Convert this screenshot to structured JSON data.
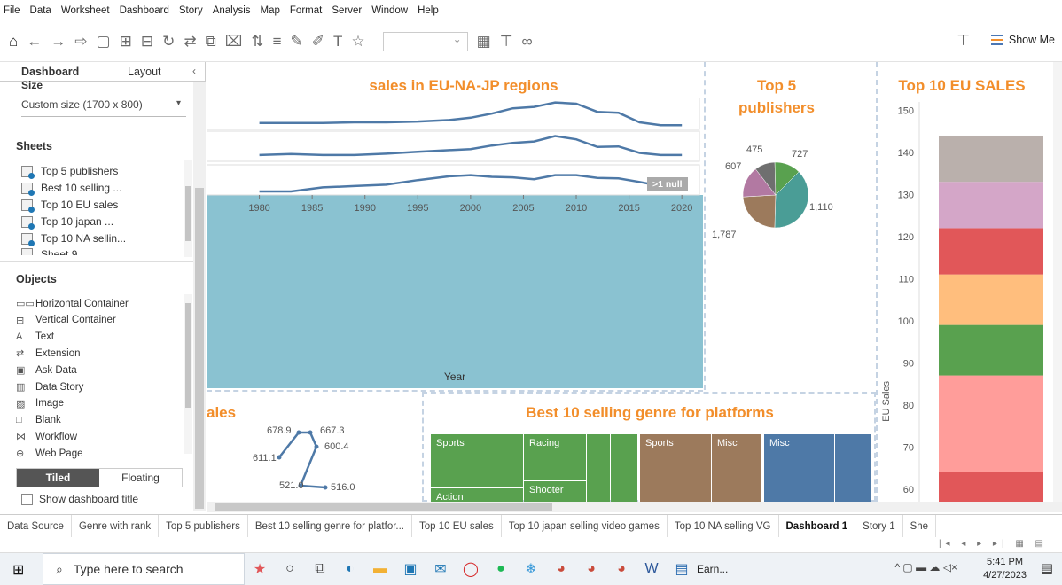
{
  "menu": [
    "File",
    "Data",
    "Worksheet",
    "Dashboard",
    "Story",
    "Analysis",
    "Map",
    "Format",
    "Server",
    "Window",
    "Help"
  ],
  "toolbar": {
    "show_me": "Show Me"
  },
  "left_panel": {
    "tab_dashboard": "Dashboard",
    "tab_layout": "Layout",
    "size_heading": "Size",
    "size_value": "Custom size (1700 x 800)",
    "sheets_heading": "Sheets",
    "sheets": [
      "Top 5 publishers",
      "Best 10 selling ...",
      "Top 10 EU sales",
      "Top 10 japan ...",
      "Top 10 NA sellin...",
      "Sheet 9"
    ],
    "objects_heading": "Objects",
    "objects": [
      {
        "icon": "horizontal-container-icon",
        "glyph": "▭▭",
        "label": "Horizontal Container"
      },
      {
        "icon": "vertical-container-icon",
        "glyph": "⊟",
        "label": "Vertical Container"
      },
      {
        "icon": "text-icon",
        "glyph": "A",
        "label": "Text"
      },
      {
        "icon": "extension-icon",
        "glyph": "⇄",
        "label": "Extension"
      },
      {
        "icon": "ask-data-icon",
        "glyph": "▣",
        "label": "Ask Data"
      },
      {
        "icon": "data-story-icon",
        "glyph": "▥",
        "label": "Data Story"
      },
      {
        "icon": "image-icon",
        "glyph": "▨",
        "label": "Image"
      },
      {
        "icon": "blank-icon",
        "glyph": "□",
        "label": "Blank"
      },
      {
        "icon": "workflow-icon",
        "glyph": "⋈",
        "label": "Workflow"
      },
      {
        "icon": "web-page-icon",
        "glyph": "⊕",
        "label": "Web Page"
      }
    ],
    "tiled": "Tiled",
    "floating": "Floating",
    "show_title": "Show dashboard title"
  },
  "dashboard": {
    "line_title": "sales in EU-NA-JP  regions",
    "null_badge": ">1 null",
    "year_label": "Year",
    "pie_title_1": "Top 5",
    "pie_title_2": "publishers",
    "bar_title": "Top 10 EU SALES",
    "bar_ylabel": "EU Sales",
    "small_title": "ales",
    "treemap_title": "Best 10 selling genre for platforms",
    "treemap_cells": [
      "Sports",
      "Racing",
      "Sports",
      "Misc",
      "Misc",
      "Shooter",
      "Action"
    ]
  },
  "chart_data": [
    {
      "type": "line",
      "title": "sales in EU-NA-JP  regions",
      "xlabel": "Year",
      "x_ticks": [
        1980,
        1985,
        1990,
        1995,
        2000,
        2005,
        2010,
        2015,
        2020
      ],
      "x": [
        1980,
        1983,
        1986,
        1989,
        1992,
        1995,
        1998,
        2000,
        2002,
        2004,
        2006,
        2008,
        2010,
        2012,
        2014,
        2016,
        2018,
        2020
      ],
      "series": [
        {
          "values": [
            1,
            1,
            1,
            1.2,
            1.2,
            1.5,
            2,
            2.8,
            4.2,
            6,
            6.5,
            8,
            7.6,
            4.8,
            4.5,
            1.2,
            0.2,
            0.2
          ]
        },
        {
          "values": [
            1,
            1.4,
            1,
            1,
            1.5,
            2.2,
            2.8,
            3.2,
            4.5,
            5.5,
            6,
            8,
            6.8,
            4,
            4.2,
            1.8,
            1,
            1
          ]
        },
        {
          "values": [
            0,
            0,
            1.5,
            2,
            2.5,
            4.2,
            5.6,
            6,
            5.4,
            5.2,
            4.5,
            6,
            6,
            5,
            4.8,
            3.5,
            2,
            1.2
          ]
        }
      ]
    },
    {
      "type": "pie",
      "title": "Top 5 publishers",
      "values": [
        1787,
        1110,
        727,
        475,
        607
      ],
      "labels": [
        "1,787",
        "1,110",
        "727",
        "475",
        "607"
      ],
      "colors": [
        "#4a9d96",
        "#9c7a5c",
        "#b279a2",
        "#6f6f6f",
        "#59a14f"
      ]
    },
    {
      "type": "bar",
      "title": "Top 10 EU SALES",
      "ylabel": "EU Sales",
      "y_ticks": [
        60,
        70,
        80,
        90,
        100,
        110,
        120,
        130,
        140,
        150
      ],
      "ylim": [
        57,
        152
      ],
      "stack_boundaries": [
        64,
        87,
        99,
        111,
        122,
        133,
        144
      ],
      "colors": [
        "#e15759",
        "#ff9d9a",
        "#59a14f",
        "#ffbe7d",
        "#e15759",
        "#d4a6c8",
        "#bab0ac"
      ]
    },
    {
      "type": "line",
      "title": "ales",
      "points": [
        611.1,
        678.9,
        667.3,
        600.4,
        521.0,
        516.0
      ],
      "labels": [
        "611.1",
        "678.9",
        "667.3",
        "600.4",
        "521.0",
        "516.0"
      ]
    }
  ],
  "sheet_tabs": [
    "Data Source",
    "Genre with rank",
    "Top 5 publishers",
    "Best 10 selling genre for platfor...",
    "Top 10 EU sales",
    "Top 10 japan selling video games",
    "Top 10 NA selling VG",
    "Dashboard 1",
    "Story 1",
    "She"
  ],
  "taskbar": {
    "search": "Type here to search",
    "app_label": "Earn...",
    "time": "5:41 PM",
    "date": "4/27/2023"
  }
}
